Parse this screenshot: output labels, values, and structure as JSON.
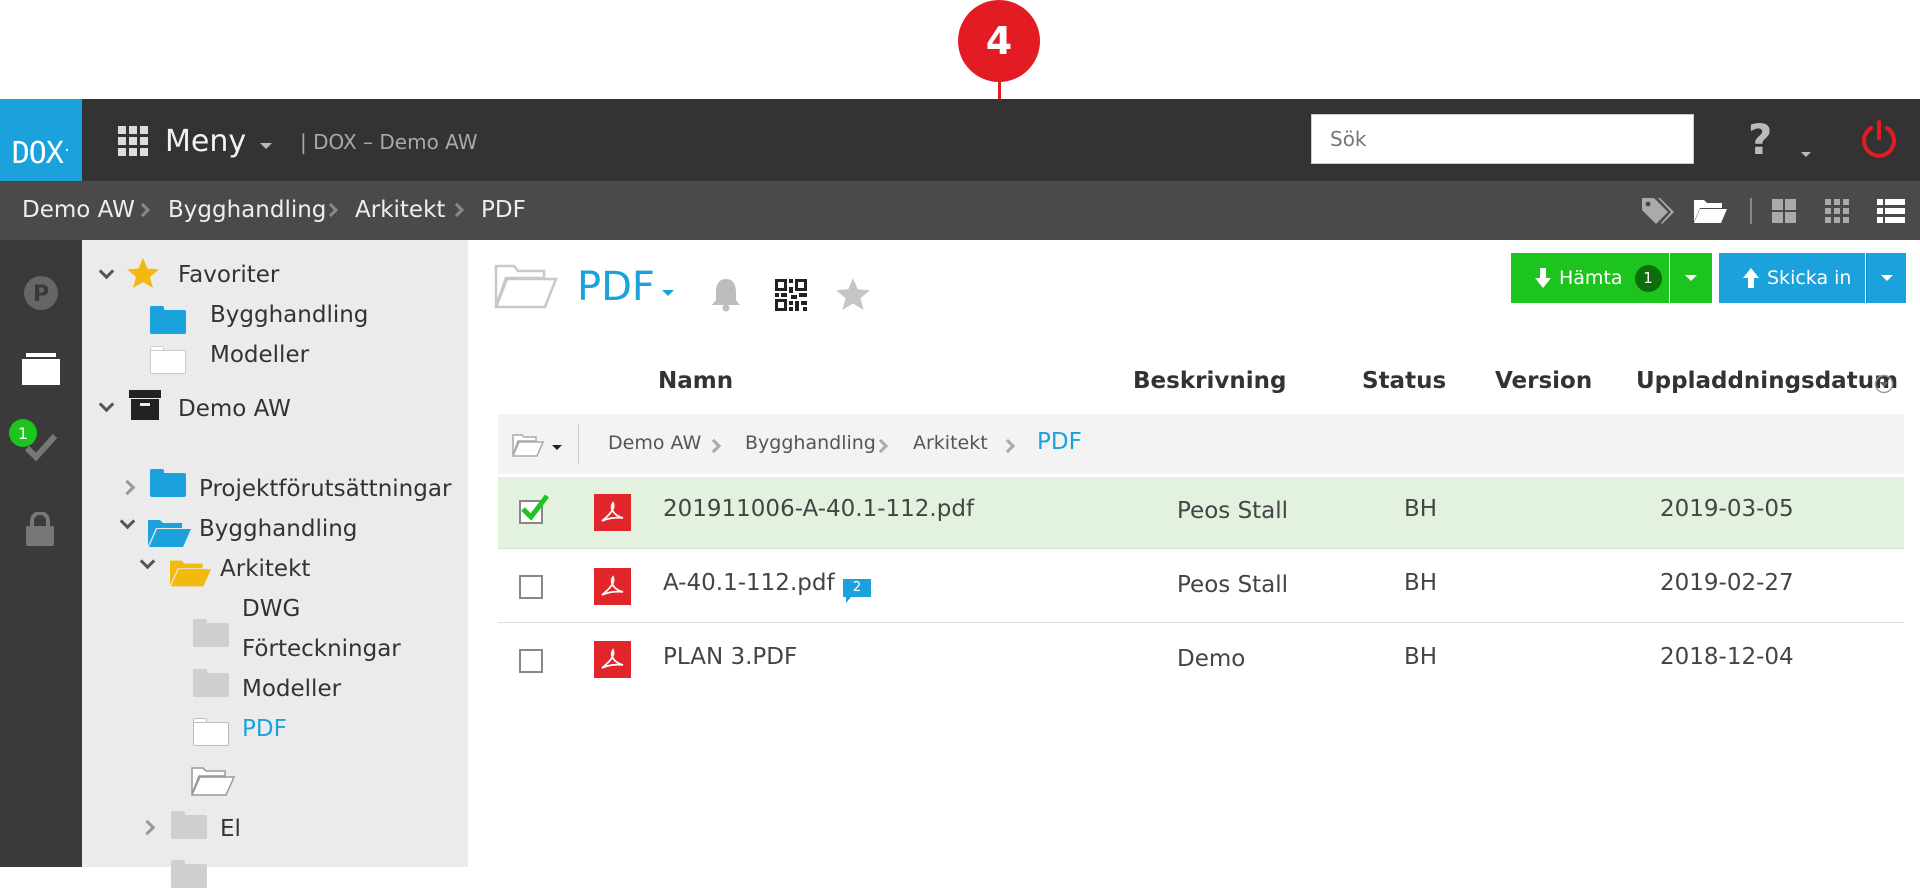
{
  "callout": {
    "number": "4"
  },
  "topbar": {
    "logo": "DOX",
    "menu_label": "Meny",
    "site_name": "| DOX – Demo AW",
    "search_placeholder": "Sök",
    "help_label": "?"
  },
  "breadcrumb": {
    "items": [
      "Demo AW",
      "Bygghandling",
      "Arkitekt",
      "PDF"
    ]
  },
  "rail": {
    "badge_count": "1"
  },
  "tree": {
    "favorites_label": "Favoriter",
    "favorites": [
      "Bygghandling",
      "Modeller"
    ],
    "project_label": "Demo AW",
    "items": [
      {
        "label": "Projektförutsättningar"
      },
      {
        "label": "Bygghandling"
      },
      {
        "label": "Arkitekt"
      },
      {
        "label": "DWG"
      },
      {
        "label": "Förteckningar"
      },
      {
        "label": "Modeller"
      },
      {
        "label": "PDF"
      },
      {
        "label": "El"
      }
    ]
  },
  "folder": {
    "title": "PDF"
  },
  "actions": {
    "download_label": "Hämta",
    "download_count": "1",
    "upload_label": "Skicka in"
  },
  "table": {
    "columns": {
      "name": "Namn",
      "description": "Beskrivning",
      "status": "Status",
      "version": "Version",
      "upload_date": "Uppladdningsdatum"
    },
    "path": [
      "Demo AW",
      "Bygghandling",
      "Arkitekt",
      "PDF"
    ],
    "rows": [
      {
        "name": "201911006-A-40.1-112.pdf",
        "description": "Peos Stall",
        "status": "BH",
        "version": "",
        "date": "2019-03-05",
        "checked": true,
        "comments": ""
      },
      {
        "name": "A-40.1-112.pdf",
        "description": "Peos Stall",
        "status": "BH",
        "version": "",
        "date": "2019-02-27",
        "checked": false,
        "comments": "2"
      },
      {
        "name": "PLAN 3.PDF",
        "description": "Demo",
        "status": "BH",
        "version": "",
        "date": "2018-12-04",
        "checked": false,
        "comments": ""
      }
    ]
  },
  "colors": {
    "brand": "#1ba1dc",
    "download": "#1ec41e",
    "upload": "#1ba1dc",
    "callout": "#e31b23",
    "selected_row": "#e3f2df",
    "pdf_icon": "#e0262b"
  }
}
